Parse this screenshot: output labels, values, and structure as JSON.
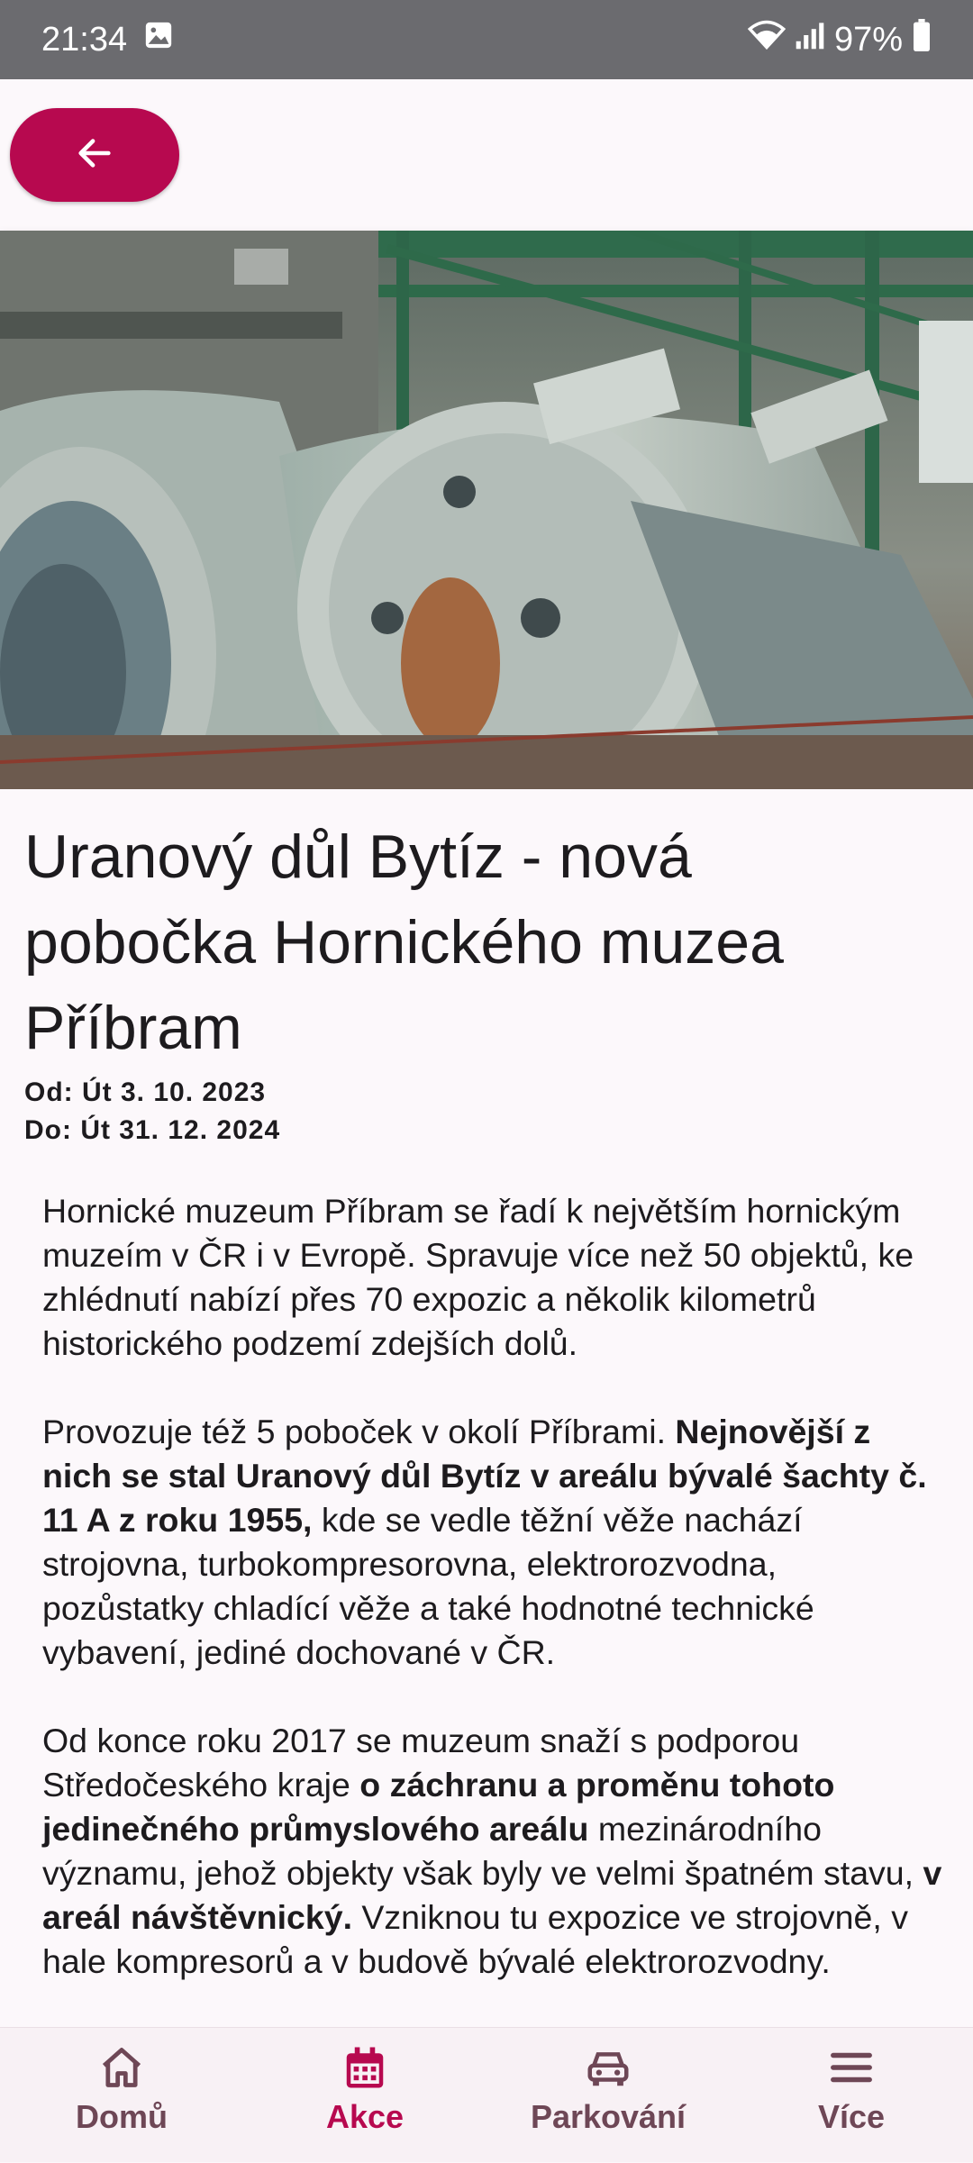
{
  "status_bar": {
    "time": "21:34",
    "battery": "97%"
  },
  "app_bar": {
    "back_icon": "arrow-left-icon"
  },
  "event": {
    "title": "Uranový důl Bytíz - nová pobočka Hornického muzea Příbram",
    "date_from": "Od: Út 3. 10. 2023",
    "date_to": "Do: Út 31. 12. 2024"
  },
  "article": {
    "p1": "Hornické muzeum Příbram se řadí k největším hornickým muzeím v ČR i v Evropě. Spravuje více než 50 objektů, ke zhlédnutí nabízí přes 70 expozic a několik kilometrů historického podzemí zdejších dolů.",
    "p2_a": "Provozuje též 5 poboček v okolí Příbrami. ",
    "p2_b": "Nejnovější z nich se stal Uranový důl Bytíz v areálu bývalé šachty č. 11 A z roku 1955,",
    "p2_c": " kde se vedle těžní věže nachází strojovna, turbokompresorovna, elektrorozvodna, pozůstatky chladící věže a také hodnotné technické vybavení, jediné dochované v ČR.",
    "p3_a": "Od konce roku 2017 se muzeum snaží s podporou Středočeského kraje ",
    "p3_b": "o záchranu a proměnu tohoto jedinečného průmyslového areálu",
    "p3_c": " mezinárodního významu, jehož objekty však byly ve velmi špatném stavu, ",
    "p3_d": "v areál návštěvnický.",
    "p3_e": " Vzniknou tu expozice ve strojovně, v hale kompresorů a v budově bývalé elektrorozvodny."
  },
  "bottom_nav": {
    "items": [
      {
        "label": "Domů",
        "icon": "home-icon"
      },
      {
        "label": "Akce",
        "icon": "calendar-icon"
      },
      {
        "label": "Parkování",
        "icon": "car-icon"
      },
      {
        "label": "Více",
        "icon": "menu-icon"
      }
    ],
    "active": "Akce"
  },
  "colors": {
    "accent": "#b7094f",
    "nav_inactive": "#6e4756",
    "background": "#fcf8fb"
  }
}
